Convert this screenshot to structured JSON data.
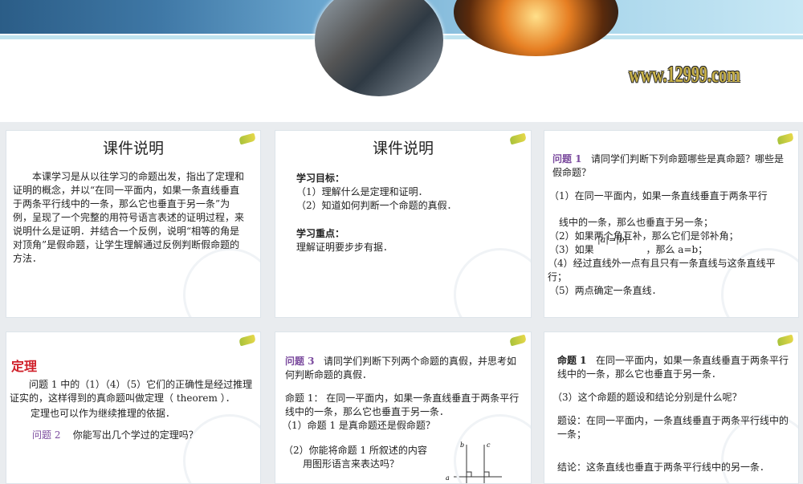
{
  "banner": {
    "logo_text": "www.12999.com"
  },
  "slides": [
    {
      "title": "课件说明",
      "body": "本课学习是从以往学习的命题出发，指出了定理和证明的概念，并以“在同一平面内，如果一条直线垂直于两条平行线中的一条，那么它也垂直于另一条”为例，呈现了一个完整的用符号语言表述的证明过程，来说明什么是证明．并结合一个反例，说明“相等的角是对顶角”是假命题，让学生理解通过反例判断假命题的方法．"
    },
    {
      "title": "课件说明",
      "goal_label": "学习目标：",
      "goals": [
        "（1）理解什么是定理和证明．",
        "（2）知道如何判断一个命题的真假．"
      ],
      "focus_label": "学习重点：",
      "focus": "理解证明要步步有据．"
    },
    {
      "q_label": "问题 1",
      "q_text": "请同学们判断下列命题哪些是真命题？哪些是假命题？",
      "items": [
        "（1）在同一平面内，如果一条直线垂直于两条平行",
        "线中的一条，那么也垂直于另一条；",
        "（2）如果两个角互补，那么它们是邻补角；",
        "（3）如果                 ，那么 a=b；",
        "（4）经过直线外一点有且只有一条直线与这条直线平行；",
        "（5）两点确定一条直线．"
      ],
      "overlay": "|a|=|b|"
    },
    {
      "heading": "定理",
      "body1": "问题 1 中的（1）（4）（5）它们的正确性是经过推理证实的，这样得到的真命题叫做定理（ theorem ）．",
      "body2": "定理也可以作为继续推理的依据．",
      "q_label": "问题 2",
      "q_text": "你能写出几个学过的定理吗？"
    },
    {
      "q_label": "问题 3",
      "q_text": "请同学们判断下列两个命题的真假，并思考如何判断命题的真假．",
      "prop": "命题 1：  在同一平面内，如果一条直线垂直于两条平行线中的一条，那么它也垂直于另一条．",
      "sub1": "（1）命题 1 是真命题还是假命题？",
      "sub2": "（2）你能将命题 1 所叙述的内容用图形语言来表达吗？",
      "fig_labels": [
        "a",
        "b",
        "c"
      ]
    },
    {
      "prop_label": "命题 1",
      "prop_text": "在同一平面内，如果一条直线垂直于两条平行线中的一条，那么它也垂直于另一条．",
      "sub3": "（3）这个命题的题设和结论分别是什么呢？",
      "hyp": "题设：在同一平面内，一条直线垂直于两条平行线中的一条；",
      "concl": "结论：这条直线也垂直于两条平行线中的另一条．"
    }
  ]
}
